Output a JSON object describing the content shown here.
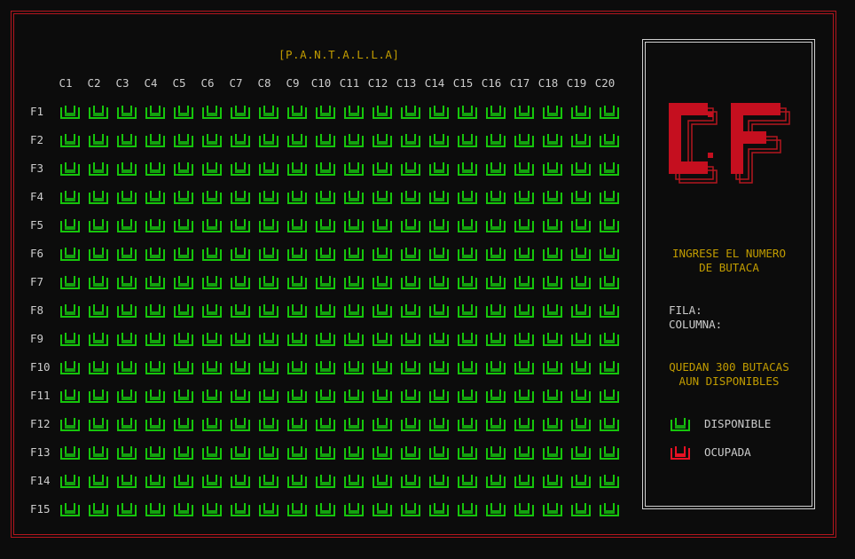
{
  "screen_label": "[P.A.N.T.A.L.L.A]",
  "columns": [
    "C1",
    "C2",
    "C3",
    "C4",
    "C5",
    "C6",
    "C7",
    "C8",
    "C9",
    "C10",
    "C11",
    "C12",
    "C13",
    "C14",
    "C15",
    "C16",
    "C17",
    "C18",
    "C19",
    "C20"
  ],
  "rows": [
    "F1",
    "F2",
    "F3",
    "F4",
    "F5",
    "F6",
    "F7",
    "F8",
    "F9",
    "F10",
    "F11",
    "F12",
    "F13",
    "F14",
    "F15"
  ],
  "seat_status": "disponible",
  "side_panel": {
    "prompt": "INGRESE EL NUMERO\nDE BUTACA",
    "fila_label": "FILA:",
    "fila_value": "",
    "columna_label": "COLUMNA:",
    "columna_value": "",
    "remaining": "QUEDAN 300 BUTACAS\nAUN DISPONIBLES",
    "legend": {
      "available_label": "DISPONIBLE",
      "occupied_label": "OCUPADA"
    }
  },
  "colors": {
    "frame": "#b4161e",
    "accent": "#c19c00",
    "seat_available": "#16c60c",
    "seat_available_dark": "#13a10e",
    "seat_occupied": "#e81123",
    "text": "#cccccc",
    "background": "#0c0c0c"
  },
  "icons": {
    "seat": "armchair-icon",
    "logo": "cf-logo-icon"
  }
}
